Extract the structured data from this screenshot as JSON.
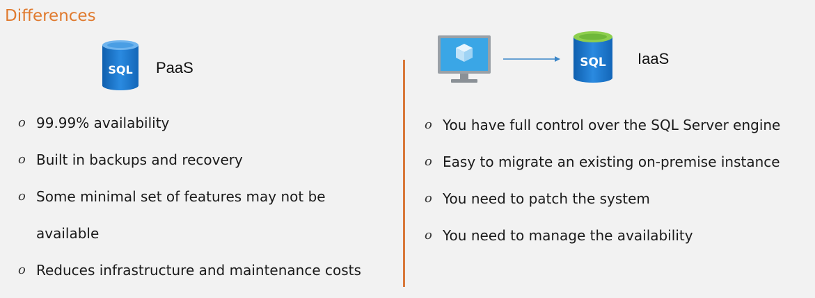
{
  "title": "Differences",
  "paas": {
    "icon": "sql-database-icon",
    "icon_text": "SQL",
    "label": "PaaS",
    "bullets": [
      {
        "text": "99.99% availability"
      },
      {
        "text": "Built in backups and recovery"
      },
      {
        "text": "Some minimal set of features may not be",
        "continuation": "available"
      },
      {
        "text": "Reduces infrastructure and maintenance costs"
      }
    ]
  },
  "iaas": {
    "monitor_icon": "virtual-machine-icon",
    "arrow_icon": "arrow-right-icon",
    "icon": "sql-database-icon",
    "icon_text": "SQL",
    "label": "IaaS",
    "bullets": [
      {
        "text": "You have full control over the SQL Server engine"
      },
      {
        "text": "Easy to migrate an existing on-premise instance"
      },
      {
        "text": "You need to patch the system"
      },
      {
        "text": "You need to manage the availability"
      }
    ]
  },
  "bullet_glyph": "o",
  "colors": {
    "accent": "#e07a2e",
    "divider": "#d9793b",
    "sql_blue": "#1f7fd4",
    "sql_green": "#7fc241"
  }
}
